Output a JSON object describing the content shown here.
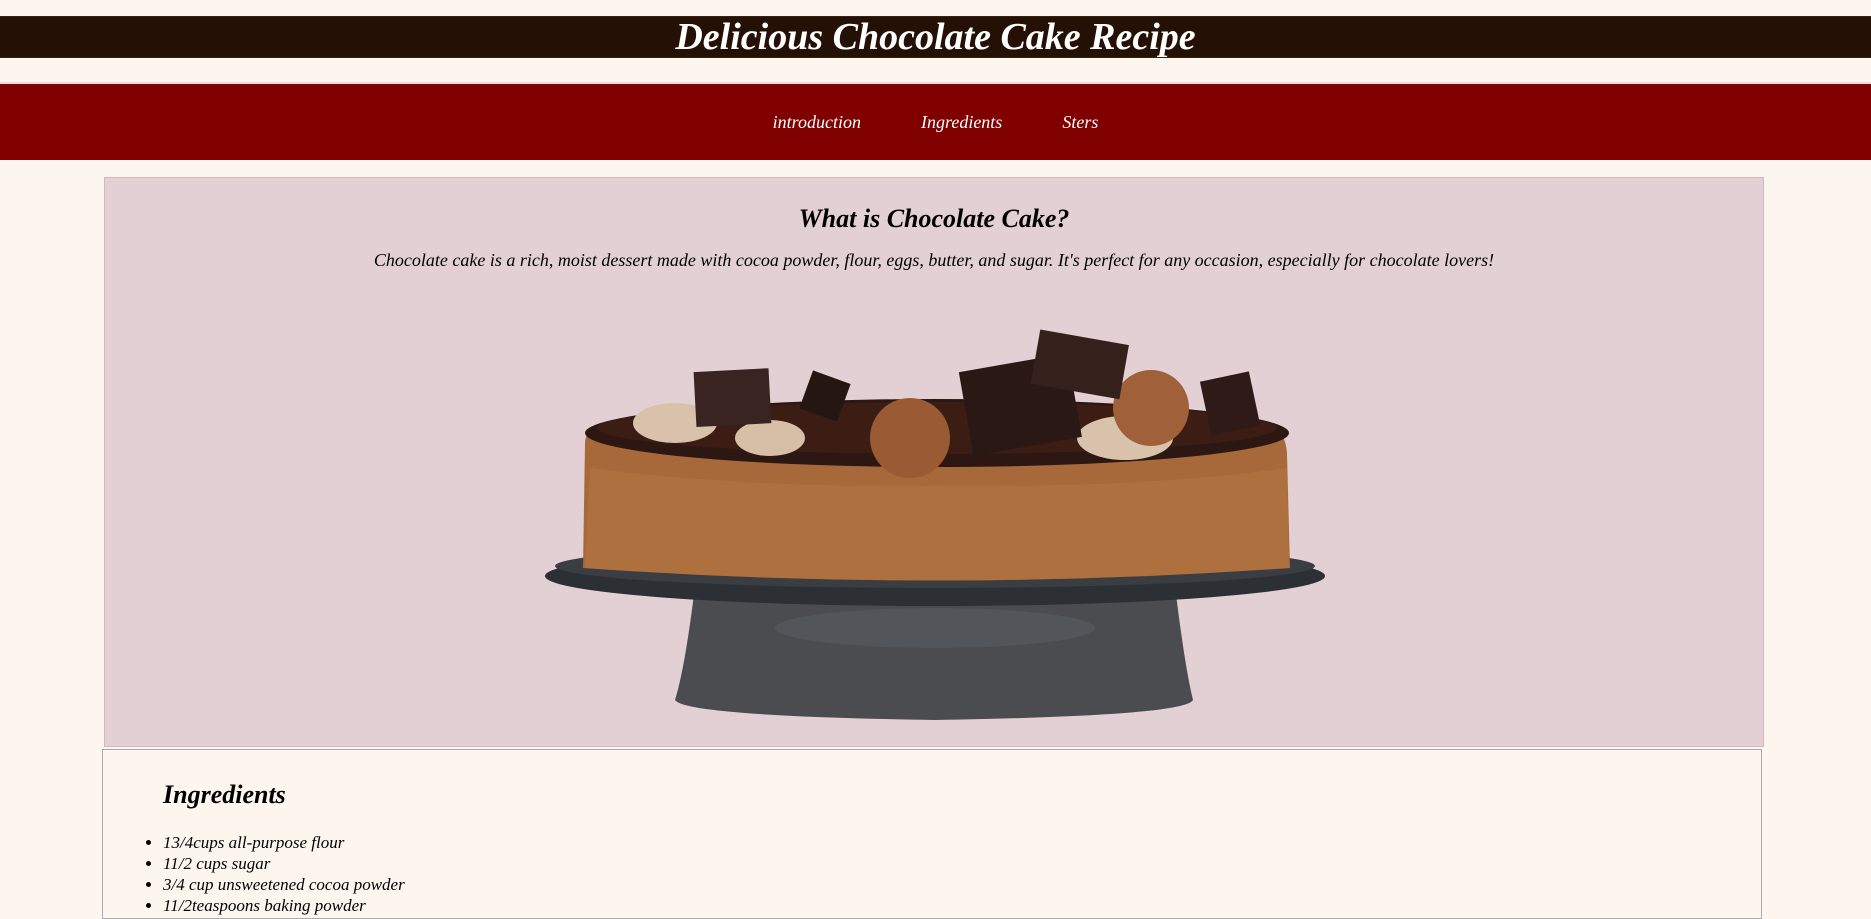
{
  "header": {
    "title": "Delicious Chocolate Cake Recipe"
  },
  "nav": {
    "items": [
      {
        "label": "introduction"
      },
      {
        "label": "Ingredients"
      },
      {
        "label": "Sters"
      }
    ]
  },
  "intro": {
    "heading": "What is Chocolate Cake?",
    "text": "Chocolate cake is a rich, moist dessert made with cocoa powder, flour, eggs, butter, and sugar. It's perfect for any occasion, especially for chocolate lovers!",
    "image_icon": "chocolate-cake-image"
  },
  "ingredients": {
    "heading": "Ingredients",
    "items": [
      "13/4cups all-purpose flour",
      "11/2 cups sugar",
      "3/4 cup unsweetened cocoa powder",
      "11/2teaspoons baking powder"
    ]
  },
  "colors": {
    "title_bar": "#241005",
    "nav_bar": "#800000",
    "intro_bg": "#e3d0d4",
    "page_bg": "#fdf6ef"
  }
}
